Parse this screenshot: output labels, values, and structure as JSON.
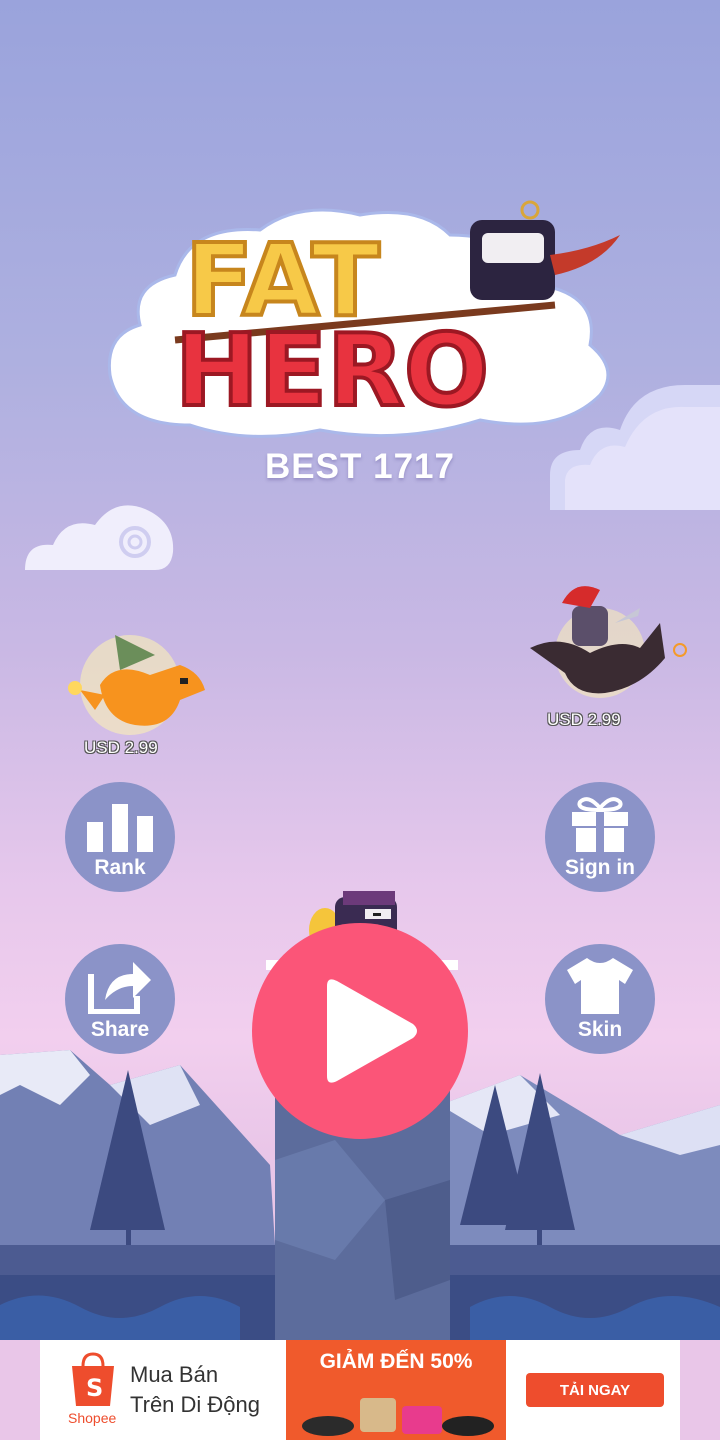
{
  "game": {
    "logo_line1": "FAT",
    "logo_line2": "HERO",
    "best_label": "BEST 1717"
  },
  "shop": {
    "left_price": "USD 2.99",
    "right_price": "USD 2.99"
  },
  "buttons": {
    "rank": "Rank",
    "sign_in": "Sign in",
    "share": "Share",
    "skin": "Skin"
  },
  "ad": {
    "brand": "Shopee",
    "title_line1": "Mua Bán",
    "title_line2": "Trên Di Động",
    "promo": "GIẢM ĐẾN 50%",
    "cta": "TẢI NGAY"
  },
  "colors": {
    "play": "#fb5578",
    "button": "#8b93c8",
    "mountain": "#5b6aa0",
    "water": "#3b4d85"
  }
}
